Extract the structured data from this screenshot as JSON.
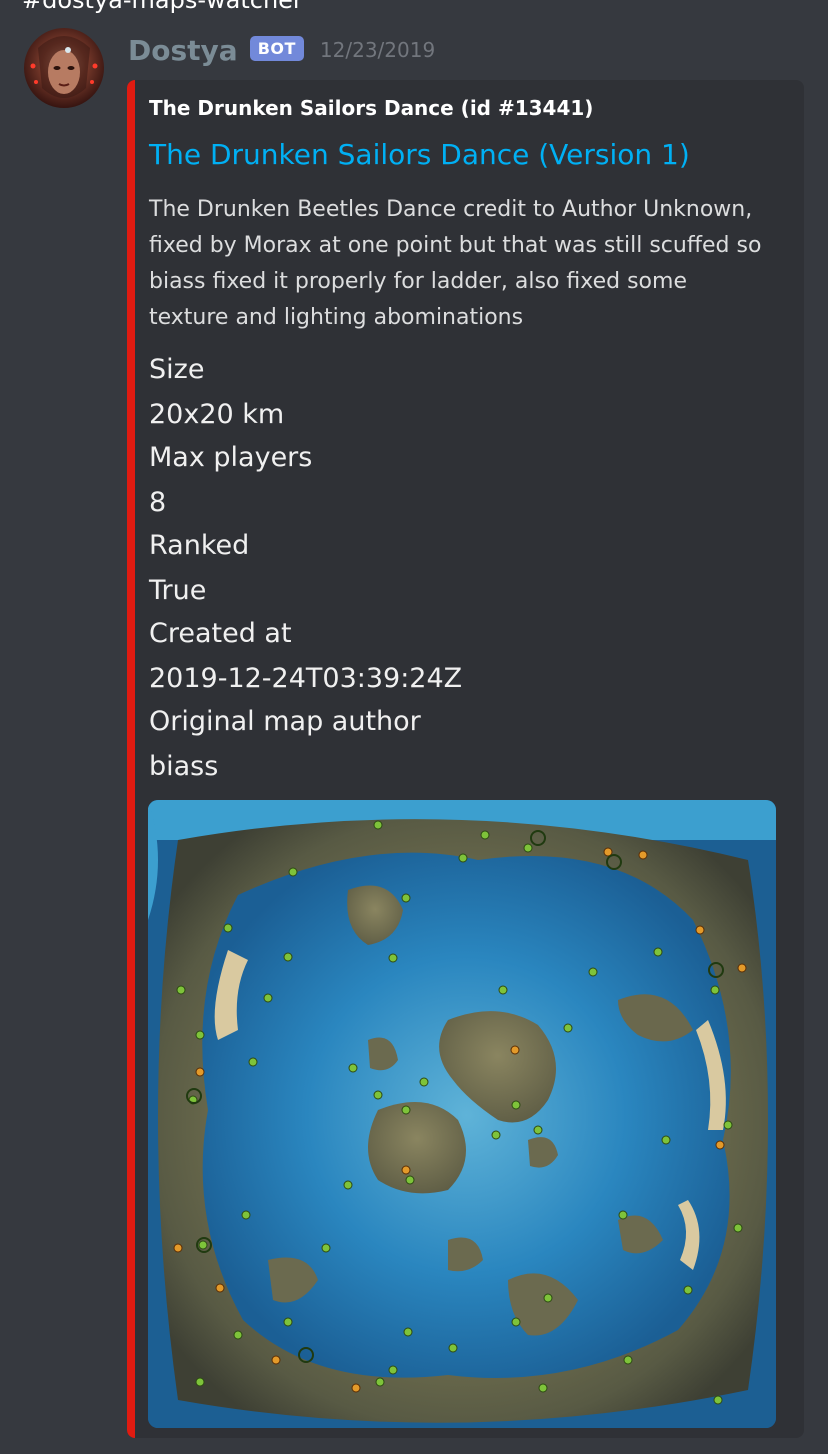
{
  "channel": {
    "header_text": "#dostya-maps-watcher"
  },
  "message": {
    "username": "Dostya",
    "badge": "BOT",
    "timestamp": "12/23/2019"
  },
  "embed": {
    "accent_color": "#e01b11",
    "author": "The Drunken Sailors Dance (id #13441)",
    "title": "The Drunken Sailors Dance (Version 1)",
    "description": "The Drunken Beetles Dance credit to Author Unknown, fixed by Morax at one point but that was still scuffed so biass fixed it properly for ladder, also fixed some texture and lighting abominations",
    "fields": [
      {
        "name": "Size",
        "value": "20x20 km"
      },
      {
        "name": "Max players",
        "value": "8"
      },
      {
        "name": "Ranked",
        "value": "True"
      },
      {
        "name": "Created at",
        "value": "2019-12-24T03:39:24Z"
      },
      {
        "name": "Original map author",
        "value": "biass"
      }
    ]
  }
}
